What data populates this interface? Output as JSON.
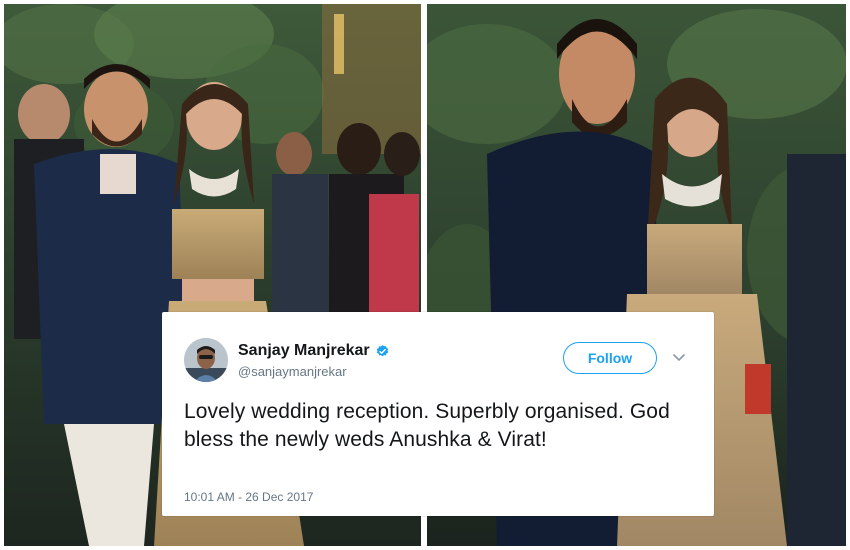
{
  "tweet": {
    "display_name": "Sanjay Manjrekar",
    "handle": "@sanjaymanjrekar",
    "follow_label": "Follow",
    "text": "Lovely wedding reception. Superbly organised. God bless the newly weds Anushka & Virat!",
    "timestamp": "10:01 AM - 26 Dec 2017",
    "accent_color": "#1da1f2",
    "verified_icon": "verified-badge-icon",
    "menu_icon": "chevron-down-icon"
  },
  "photos": [
    {
      "name": "couple-photo-left"
    },
    {
      "name": "couple-photo-right"
    }
  ]
}
